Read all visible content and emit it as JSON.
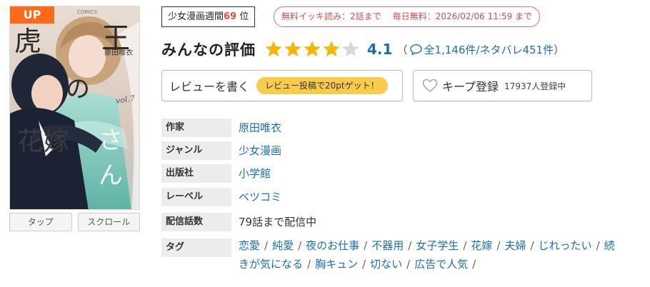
{
  "cover": {
    "badge": "UP",
    "title_parts": [
      "虎",
      "王",
      "の",
      "花嫁",
      "さん"
    ],
    "author_on_cover": "原田唯衣",
    "volume": "vol.7",
    "imprint": "COMICS"
  },
  "view_buttons": [
    "タップ",
    "スクロール"
  ],
  "ranking": {
    "prefix": "少女漫画週間",
    "rank": "69",
    "suffix": "位"
  },
  "free_info": {
    "free_read": "無料イッキ読み：2話まで",
    "daily_free": "毎日無料：2026/02/06 11:59 まで"
  },
  "rating": {
    "title": "みんなの評価",
    "value": 4.1,
    "max": 5,
    "score_text": "4.1",
    "count_open": "（",
    "count_text": "全1,146件/ネタバレ451件",
    "count_close": "）"
  },
  "review_button": {
    "label": "レビューを書く",
    "pill": "レビュー投稿で20ptゲット！"
  },
  "keep_button": {
    "label": "キープ登録",
    "count": "17937人登録中"
  },
  "info": [
    {
      "label": "作家",
      "value": "原田唯衣",
      "link": true
    },
    {
      "label": "ジャンル",
      "value": "少女漫画",
      "link": true
    },
    {
      "label": "出版社",
      "value": "小学館",
      "link": true
    },
    {
      "label": "レーベル",
      "value": "ベツコミ",
      "link": true
    },
    {
      "label": "配信話数",
      "value": "79話まで配信中",
      "link": false
    }
  ],
  "tags_label": "タグ",
  "tags": [
    "恋愛",
    "純愛",
    "夜のお仕事",
    "不器用",
    "女子学生",
    "花嫁",
    "夫婦",
    "じれったい",
    "続きが気になる",
    "胸キュン",
    "切ない",
    "広告で人気"
  ],
  "colors": {
    "link": "#1a6fb3",
    "star": "#f5b800",
    "star_empty": "#d9d9d9",
    "rank_number": "#e74c3c",
    "free_badge": "#d05050",
    "up_badge": "#ff6a1a",
    "pill": "#f8cc4a",
    "label_bg": "#ececec"
  },
  "icons": {
    "comment": "speech-bubble-icon",
    "keep": "heart-outline-icon",
    "star": "star-icon"
  }
}
